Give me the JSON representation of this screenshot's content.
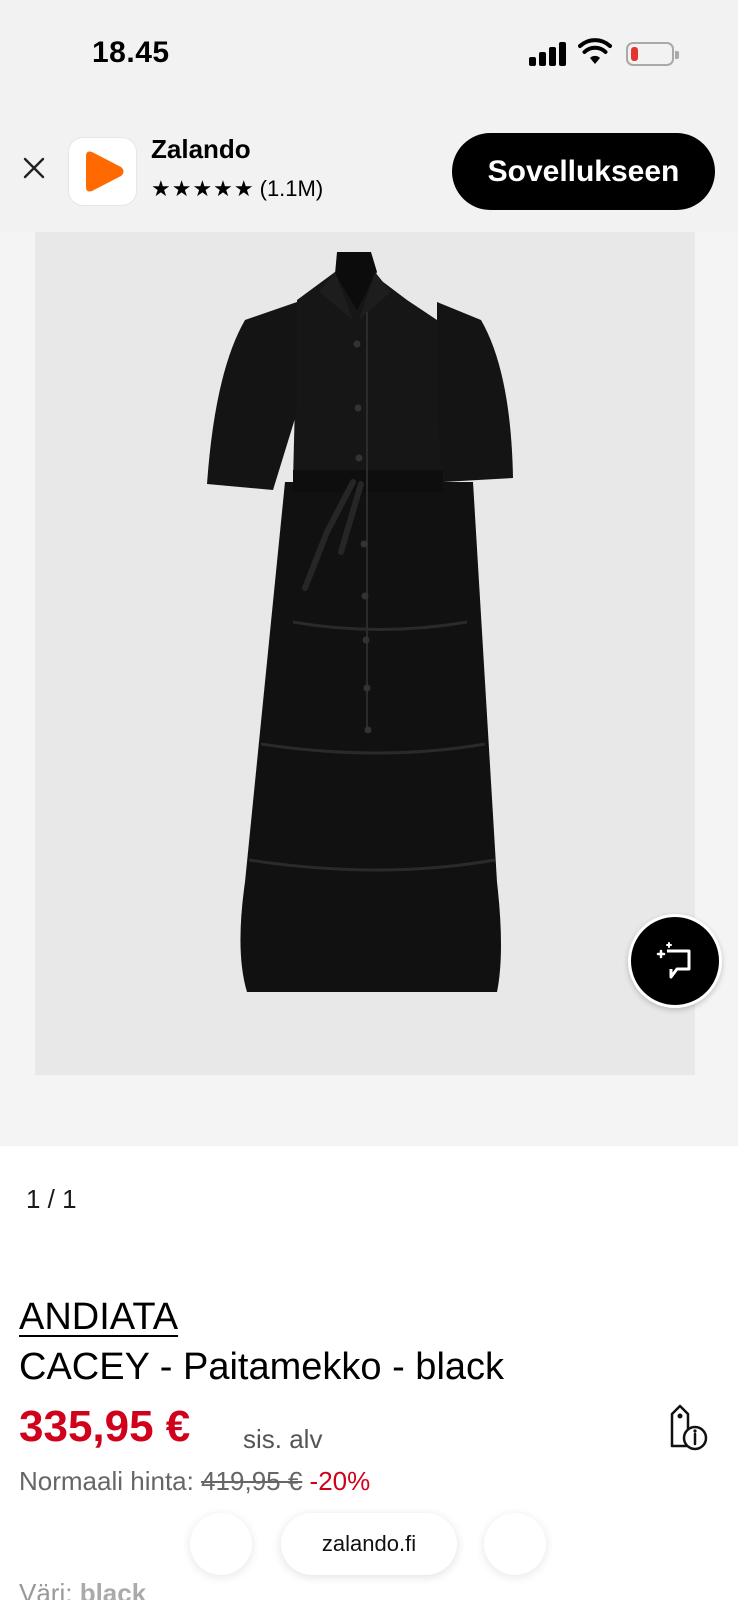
{
  "status_bar": {
    "time": "18.45",
    "battery_color": "#e5352f"
  },
  "app_banner": {
    "close_icon": "close-icon",
    "app_name": "Zalando",
    "stars": "★★★★★",
    "rating_count": "(1.1M)",
    "open_button": "Sovellukseen",
    "brand_color": "#ff6900"
  },
  "gallery": {
    "pager": "1 / 1",
    "fab_icon": "sparkle-crop-icon"
  },
  "product": {
    "brand": "ANDIATA",
    "name": "CACEY - Paitamekko - black",
    "price": "335,95 €",
    "vat_note": "sis. alv",
    "normal_price_label": "Normaali hinta:",
    "normal_price": "419,95 €",
    "discount": "-20%",
    "color_label": "Väri:",
    "color_value": "black",
    "price_color": "#d0021b"
  },
  "browser": {
    "url": "zalando.fi"
  }
}
